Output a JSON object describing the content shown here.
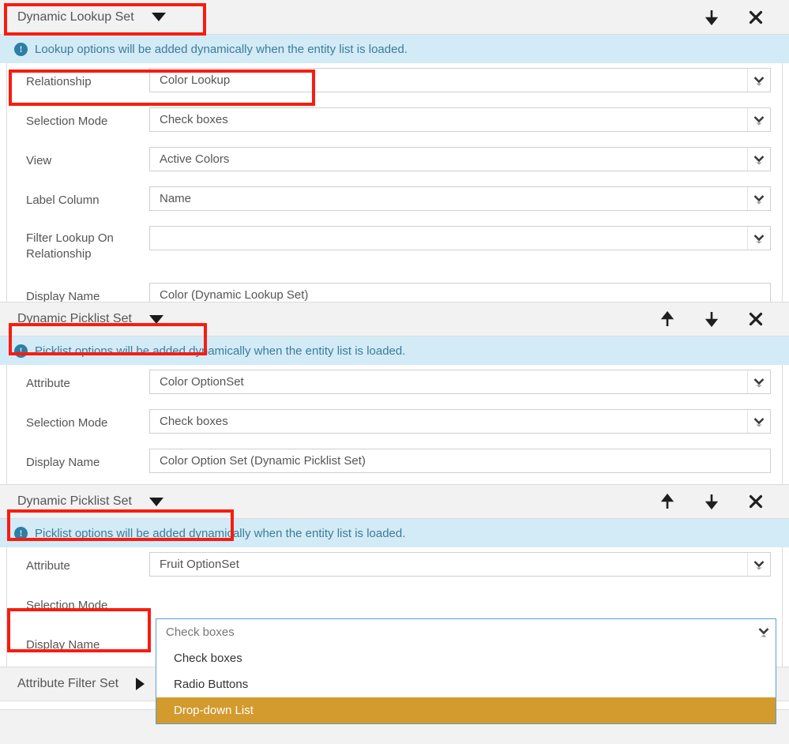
{
  "sections": [
    {
      "title": "Dynamic Lookup Set",
      "caret": "caret-down-icon",
      "info": "Lookup options will be added dynamically when the entity list is loaded.",
      "actions": [
        "move-down-icon",
        "remove-icon"
      ],
      "rows": [
        {
          "label": "Relationship",
          "value": "Color Lookup",
          "type": "select"
        },
        {
          "label": "Selection Mode",
          "value": "Check boxes",
          "type": "select"
        },
        {
          "label": "View",
          "value": "Active Colors",
          "type": "select"
        },
        {
          "label": "Label Column",
          "value": "Name",
          "type": "select"
        },
        {
          "label": "Filter Lookup On Relationship",
          "value": "",
          "type": "select"
        },
        {
          "label": "Display Name",
          "value": "Color (Dynamic Lookup Set)",
          "type": "text"
        }
      ]
    },
    {
      "title": "Dynamic Picklist Set",
      "caret": "caret-down-icon",
      "info": "Picklist options will be added dynamically when the entity list is loaded.",
      "actions": [
        "move-up-icon",
        "move-down-icon",
        "remove-icon"
      ],
      "rows": [
        {
          "label": "Attribute",
          "value": "Color OptionSet",
          "type": "select"
        },
        {
          "label": "Selection Mode",
          "value": "Check boxes",
          "type": "select"
        },
        {
          "label": "Display Name",
          "value": "Color Option Set (Dynamic Picklist Set)",
          "type": "text"
        }
      ]
    },
    {
      "title": "Dynamic Picklist Set",
      "caret": "caret-down-icon",
      "info": "Picklist options will be added dynamically when the entity list is loaded.",
      "actions": [
        "move-up-icon",
        "move-down-icon",
        "remove-icon"
      ],
      "rows": [
        {
          "label": "Attribute",
          "value": "Fruit OptionSet",
          "type": "select"
        },
        {
          "label": "Selection Mode",
          "value": "Check boxes",
          "type": "open-select"
        },
        {
          "label": "Display Name",
          "value": "",
          "type": "text"
        }
      ]
    }
  ],
  "open_dropdown": {
    "current_value": "Check boxes",
    "options": [
      "Check boxes",
      "Radio Buttons",
      "Drop-down List"
    ],
    "selected_index": 2,
    "highlight_color": "#d39a2e"
  },
  "collapsed_section": {
    "title": "Attribute Filter Set",
    "caret": "caret-right-icon"
  },
  "annotations": {
    "color": "#f81c10",
    "boxes": [
      {
        "name": "highlight-dynamic-lookup-set-header"
      },
      {
        "name": "highlight-relationship-row"
      },
      {
        "name": "highlight-dynamic-picklist-set-header-1"
      },
      {
        "name": "highlight-dynamic-picklist-set-header-2"
      },
      {
        "name": "highlight-selection-mode-label"
      }
    ]
  }
}
